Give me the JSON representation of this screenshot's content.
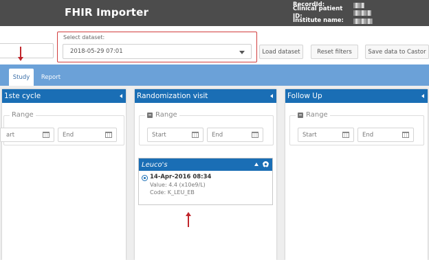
{
  "header": {
    "title": "FHIR Importer",
    "meta": [
      {
        "label": "RecordId:"
      },
      {
        "label": "Clinical patient ID:"
      },
      {
        "label": "Institute name:"
      }
    ]
  },
  "controls": {
    "dataset_label": "Select dataset:",
    "dataset_value": "2018-05-29 07:01",
    "load_label": "Load dataset",
    "reset_label": "Reset filters",
    "save_label": "Save data to Castor"
  },
  "tabs": [
    {
      "label": "Study",
      "active": true
    },
    {
      "label": "Report",
      "active": false
    }
  ],
  "panels": [
    {
      "title": "1ste cycle",
      "range_label": "Range",
      "start_placeholder": "Start",
      "start_visible": "art",
      "end_placeholder": "End"
    },
    {
      "title": "Randomization visit",
      "range_label": "Range",
      "start_placeholder": "Start",
      "end_placeholder": "End"
    },
    {
      "title": "Follow Up",
      "range_label": "Range",
      "start_placeholder": "Start",
      "end_placeholder": "End"
    }
  ],
  "card": {
    "title": "Leuco's",
    "date": "14-Apr-2016 08:34",
    "value_line": "Value: 4.4 (x10e9/L)",
    "code_line": "Code: K_LEU_EB"
  },
  "colors": {
    "header_bg": "#4c4c4c",
    "tabbar_bg": "#6ba1d8",
    "panel_header": "#1a6eb5",
    "highlight_border": "#d13b3b",
    "annotation_arrow": "#c0262c"
  }
}
